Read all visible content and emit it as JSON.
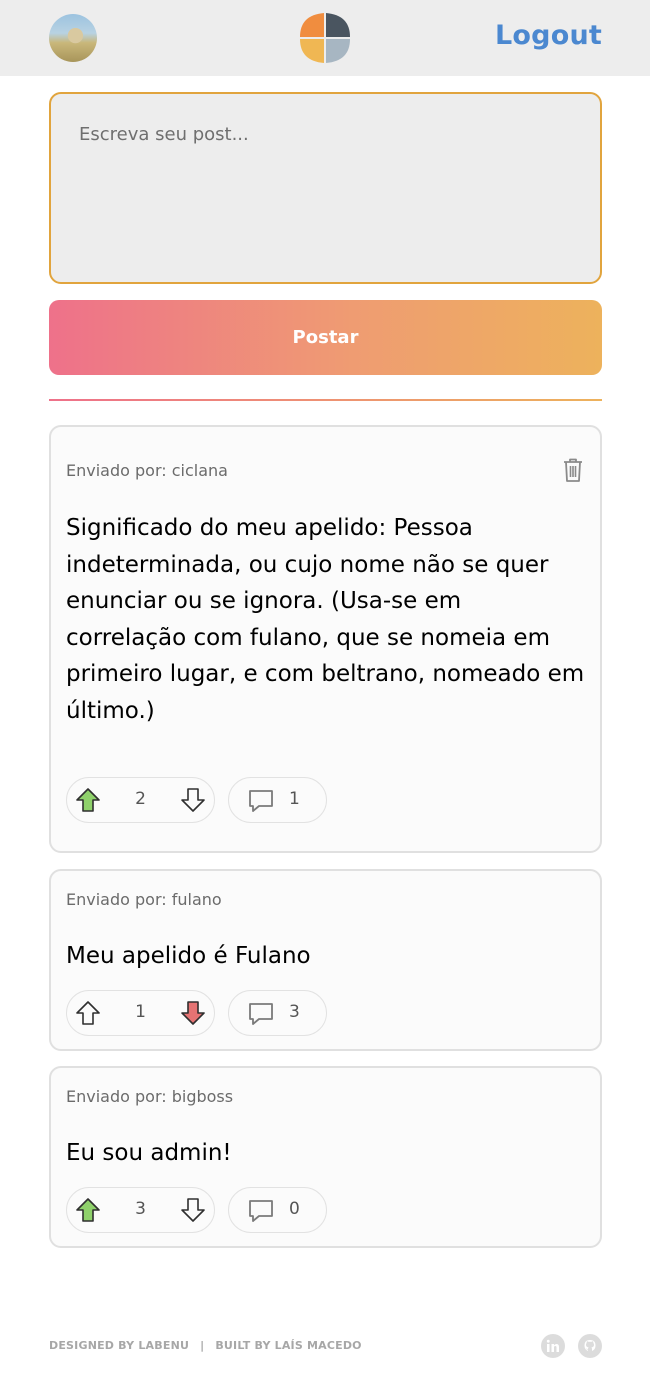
{
  "header": {
    "logout_label": "Logout",
    "avatar_icon": "user-avatar",
    "logo_icon": "labeddit-logo"
  },
  "composer": {
    "placeholder": "Escreva seu post...",
    "value": "",
    "submit_label": "Postar"
  },
  "posts": [
    {
      "author": "Enviado por: ciclana",
      "content": "Significado do meu apelido: Pessoa indeterminada, ou cujo nome não se quer enunciar ou se ignora. (Usa-se em correlação com fulano, que se nomeia em primeiro lugar, e com beltrano, nomeado em último.)",
      "votes": "2",
      "comments": "1",
      "vote_state": "up",
      "deletable": true
    },
    {
      "author": "Enviado por: fulano",
      "content": "Meu apelido é Fulano",
      "votes": "1",
      "comments": "3",
      "vote_state": "down",
      "deletable": false
    },
    {
      "author": "Enviado por: bigboss",
      "content": "Eu sou admin!",
      "votes": "3",
      "comments": "0",
      "vote_state": "up",
      "deletable": false
    }
  ],
  "footer": {
    "designed_by": "DESIGNED BY LABENU",
    "separator": "|",
    "built_by": "BUILT BY LAÍS MACEDO",
    "social_icons": [
      "linkedin-icon",
      "github-icon"
    ]
  },
  "colors": {
    "accent_blue": "#4b88d0",
    "gradient_start": "#ee718a",
    "gradient_end": "#edb25c",
    "upvote_active": "#8fd16b",
    "downvote_active": "#e57373",
    "input_border": "#e1a43d"
  }
}
